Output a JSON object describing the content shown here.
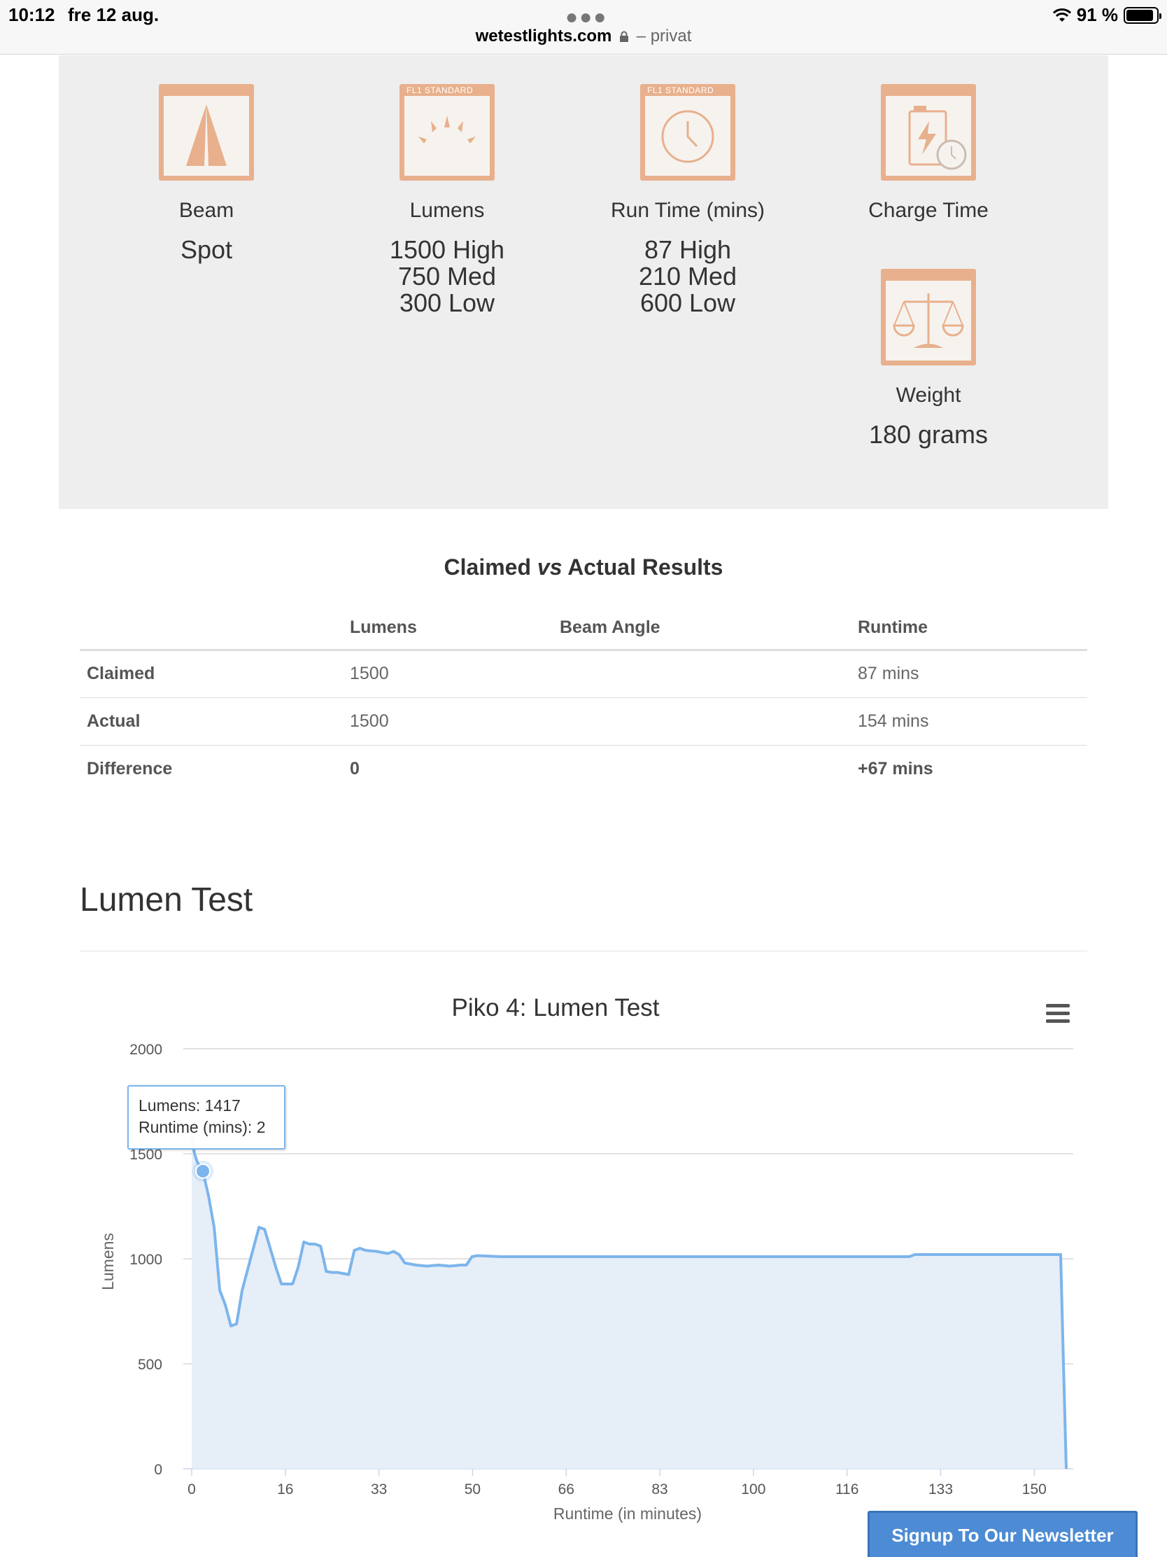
{
  "status_bar": {
    "time": "10:12",
    "date": "fre 12 aug.",
    "domain": "wetestlights.com",
    "privacy": "– privat",
    "battery": "91 %",
    "battery_level": 0.91
  },
  "specs": {
    "icon_band_text": "FL1 STANDARD",
    "accent_color": "#e8b08c",
    "items": [
      {
        "icon": "beam-icon",
        "label": "Beam",
        "value": "Spot"
      },
      {
        "icon": "lumens-icon",
        "label": "Lumens",
        "value_lines": [
          "1500 High",
          "750 Med",
          "300 Low"
        ]
      },
      {
        "icon": "clock-icon",
        "label": "Run Time (mins)",
        "value_lines": [
          "87 High",
          "210 Med",
          "600 Low"
        ]
      },
      {
        "icon": "battery-charge-icon",
        "label": "Charge Time",
        "value": ""
      },
      {
        "icon": "scale-icon",
        "label": "Weight",
        "value": "180 grams"
      }
    ]
  },
  "comparison": {
    "title_pre": "Claimed ",
    "title_em": "vs",
    "title_post": " Actual Results",
    "headers": [
      "",
      "Lumens",
      "Beam Angle",
      "Runtime"
    ],
    "rows": [
      {
        "label": "Claimed",
        "lumens": "1500",
        "beam": "",
        "runtime": "87 mins"
      },
      {
        "label": "Actual",
        "lumens": "1500",
        "beam": "",
        "runtime": "154 mins"
      },
      {
        "label": "Difference",
        "lumens": "0",
        "beam": "",
        "runtime": "+67 mins"
      }
    ]
  },
  "section_title": "Lumen Test",
  "chart_data": {
    "type": "area",
    "title": "Piko 4: Lumen Test",
    "xlabel": "Runtime (in minutes)",
    "ylabel": "Lumens",
    "ylim": [
      0,
      2000
    ],
    "xlim": [
      0,
      157
    ],
    "y_ticks": [
      0,
      500,
      1000,
      1500,
      2000
    ],
    "x_tick_labels": [
      "0",
      "16",
      "33",
      "50",
      "66",
      "83",
      "100",
      "116",
      "133",
      "150"
    ],
    "x_tick_values": [
      0,
      16.7,
      33.4,
      50.1,
      66.8,
      83.5,
      100.2,
      116.9,
      133.6,
      150.3
    ],
    "line_color": "#7cb5ec",
    "fill_color": "#e6eef8",
    "grid": true,
    "series": [
      {
        "name": "Lumens",
        "x": [
          0,
          0.5,
          1,
          2,
          3,
          4,
          5,
          6,
          7,
          8,
          9,
          10,
          11,
          12,
          13,
          14,
          15,
          16,
          17,
          18,
          19,
          20,
          21,
          22,
          23,
          24,
          25,
          26,
          27,
          28,
          29,
          30,
          31,
          33,
          35,
          36,
          37,
          38,
          40,
          42,
          44,
          46,
          48,
          49,
          50,
          51,
          55,
          60,
          70,
          80,
          90,
          100,
          110,
          120,
          128,
          129,
          131,
          135,
          140,
          145,
          150,
          155,
          155.5,
          156
        ],
        "y": [
          1580,
          1500,
          1460,
          1417,
          1300,
          1150,
          850,
          780,
          680,
          690,
          850,
          950,
          1050,
          1150,
          1140,
          1050,
          960,
          880,
          880,
          880,
          960,
          1080,
          1070,
          1070,
          1060,
          940,
          935,
          935,
          930,
          925,
          1040,
          1050,
          1040,
          1035,
          1025,
          1035,
          1020,
          980,
          970,
          965,
          970,
          965,
          970,
          970,
          1010,
          1015,
          1010,
          1010,
          1010,
          1010,
          1010,
          1010,
          1010,
          1010,
          1010,
          1020,
          1020,
          1020,
          1020,
          1020,
          1020,
          1020,
          500,
          0
        ]
      }
    ]
  },
  "tooltip": {
    "line1": "Lumens: 1417",
    "line2": "Runtime (mins): 2",
    "point_x": 2,
    "point_y": 1417
  },
  "newsletter_label": "Signup To Our Newsletter"
}
